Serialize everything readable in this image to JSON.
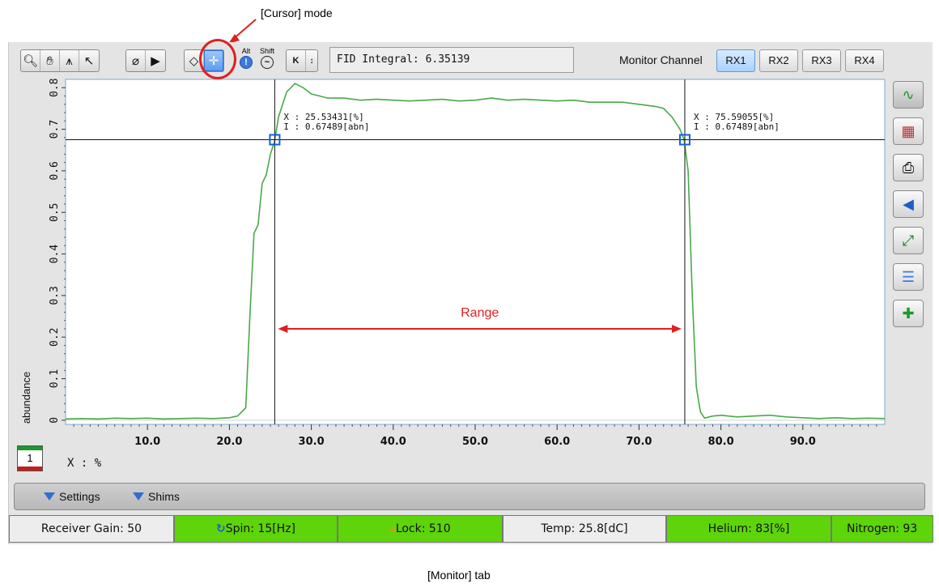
{
  "annotations": {
    "cursor_mode_label": "[Cursor] mode",
    "monitor_tab_label": "[Monitor] tab",
    "range_label": "Range"
  },
  "toolbar": {
    "alt_label": "Alt",
    "shift_label": "Shift",
    "fid_integral_text": "FID Integral: 6.35139",
    "monitor_channel_label": "Monitor Channel",
    "channels": [
      "RX1",
      "RX2",
      "RX3",
      "RX4"
    ],
    "active_channel": "RX1"
  },
  "cursors": [
    {
      "x_text": "X : 25.53431[%]",
      "i_text": "I : 0.67489[abn]"
    },
    {
      "x_text": "X : 75.59055[%]",
      "i_text": "I : 0.67489[abn]"
    }
  ],
  "chart_data": {
    "type": "line",
    "xlabel": "X : %",
    "ylabel": "abundance",
    "xlim": [
      0,
      100
    ],
    "ylim": [
      -0.01,
      0.82
    ],
    "x_ticks": [
      10.0,
      20.0,
      30.0,
      40.0,
      50.0,
      60.0,
      70.0,
      80.0,
      90.0
    ],
    "y_ticks": [
      0,
      0.1,
      0.2,
      0.3,
      0.4,
      0.5,
      0.6,
      0.7,
      0.8
    ],
    "cursor_x": [
      25.53431,
      75.59055
    ],
    "cursor_y": 0.67489,
    "series": [
      {
        "color": "#4aa84a",
        "x": [
          0,
          2,
          4,
          6,
          8,
          10,
          12,
          14,
          16,
          18,
          20,
          21,
          22,
          22.5,
          23,
          23.5,
          24,
          24.5,
          25,
          25.5,
          26,
          27,
          28,
          29,
          30,
          31,
          32,
          34,
          36,
          38,
          40,
          42,
          44,
          46,
          48,
          50,
          52,
          54,
          56,
          58,
          60,
          62,
          64,
          66,
          68,
          70,
          72,
          73,
          74,
          75,
          75.5,
          76,
          76.5,
          77,
          77.5,
          78,
          79,
          80,
          82,
          84,
          86,
          88,
          90,
          92,
          94,
          96,
          98,
          100
        ],
        "y": [
          0.003,
          0.004,
          0.003,
          0.005,
          0.004,
          0.005,
          0.003,
          0.004,
          0.005,
          0.004,
          0.006,
          0.01,
          0.03,
          0.25,
          0.45,
          0.47,
          0.57,
          0.59,
          0.64,
          0.67,
          0.73,
          0.79,
          0.81,
          0.8,
          0.785,
          0.78,
          0.775,
          0.775,
          0.77,
          0.772,
          0.77,
          0.768,
          0.77,
          0.772,
          0.768,
          0.77,
          0.775,
          0.77,
          0.772,
          0.77,
          0.768,
          0.77,
          0.765,
          0.765,
          0.765,
          0.76,
          0.755,
          0.75,
          0.73,
          0.7,
          0.675,
          0.6,
          0.3,
          0.08,
          0.02,
          0.005,
          0.01,
          0.012,
          0.008,
          0.01,
          0.012,
          0.008,
          0.006,
          0.004,
          0.006,
          0.004,
          0.005,
          0.004
        ]
      }
    ]
  },
  "page_badge": "1",
  "settings_bar": {
    "settings_label": "Settings",
    "shims_label": "Shims"
  },
  "status": {
    "receiver_gain": "Receiver Gain: 50",
    "spin": "Spin: 15[Hz]",
    "lock": "Lock: 510",
    "temp": "Temp: 25.8[dC]",
    "helium": "Helium: 83[%]",
    "nitrogen": "Nitrogen: 93"
  },
  "colors": {
    "trace": "#4aa84a",
    "cursor_marker": "#1060e0",
    "annotation": "#e02020",
    "status_green": "#5ed40a"
  }
}
